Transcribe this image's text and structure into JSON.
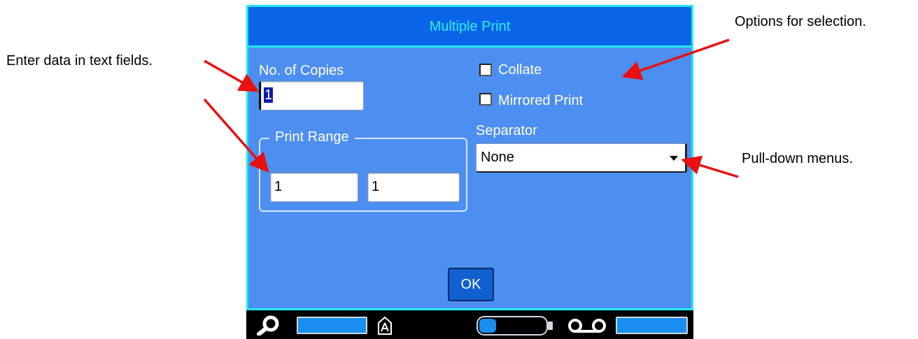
{
  "callouts": {
    "text_fields": "Enter data in text fields.",
    "options": "Options for selection.",
    "pulldown": "Pull-down menus."
  },
  "dialog": {
    "title": "Multiple Print",
    "copies": {
      "label": "No. of Copies",
      "value": "1"
    },
    "print_range": {
      "label": "Print Range",
      "from": "1",
      "to": "1"
    },
    "collate": {
      "label": "Collate",
      "checked": false
    },
    "mirrored": {
      "label": "Mirrored Print",
      "checked": false
    },
    "separator": {
      "label": "Separator",
      "value": "None"
    },
    "ok_label": "OK"
  },
  "status_bar": {
    "icons": [
      "search-icon",
      "label-type-icon",
      "battery-icon",
      "ribbon-cassette-icon"
    ]
  },
  "colors": {
    "dialog_bg": "#4d8ff0",
    "title_bg": "#0a64e8",
    "title_text": "#30f0f8",
    "border_accent": "#20e8f0",
    "arrow": "#e81010"
  }
}
